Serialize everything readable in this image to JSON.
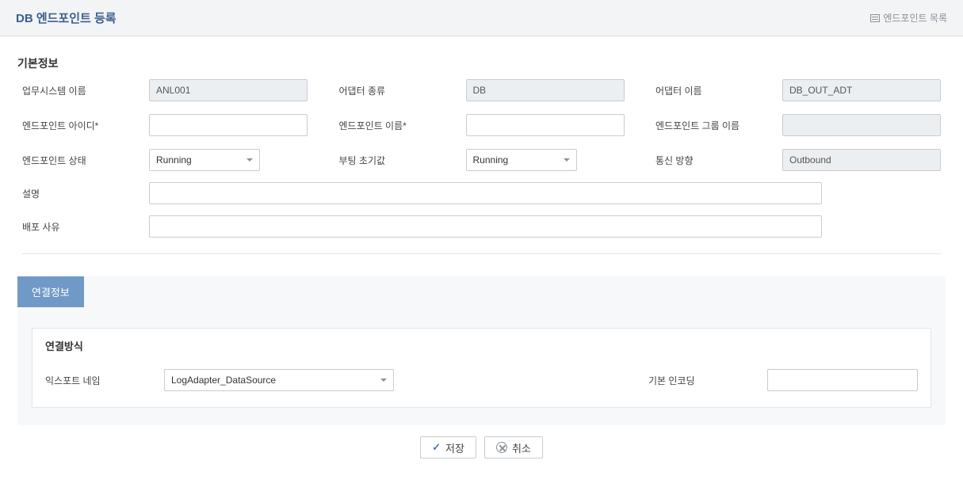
{
  "header": {
    "title": "DB 엔드포인트 등록",
    "list_link": "엔드포인트 목록"
  },
  "basic": {
    "section_title": "기본정보",
    "labels": {
      "system_name": "업무시스템 이름",
      "adapter_type": "어댑터 종류",
      "adapter_name": "어댑터 이름",
      "endpoint_id": "엔드포인트 아이디*",
      "endpoint_name": "엔드포인트 이름*",
      "endpoint_group": "엔드포인트 그룹 이름",
      "endpoint_status": "엔드포인트 상태",
      "boot_init": "부팅 초기값",
      "comm_dir": "통신 방향",
      "desc": "설명",
      "deploy_reason": "배포 사유"
    },
    "values": {
      "system_name": "ANL001",
      "adapter_type": "DB",
      "adapter_name": "DB_OUT_ADT",
      "endpoint_id": "",
      "endpoint_name": "",
      "endpoint_group": "",
      "endpoint_status": "Running",
      "boot_init": "Running",
      "comm_dir": "Outbound",
      "desc": "",
      "deploy_reason": ""
    }
  },
  "conn": {
    "tab_label": "연결정보",
    "section_title": "연결방식",
    "labels": {
      "export_name": "익스포트 네임",
      "default_encoding": "기본 인코딩"
    },
    "values": {
      "export_name": "LogAdapter_DataSource",
      "default_encoding": ""
    }
  },
  "buttons": {
    "save": "저장",
    "cancel": "취소"
  }
}
